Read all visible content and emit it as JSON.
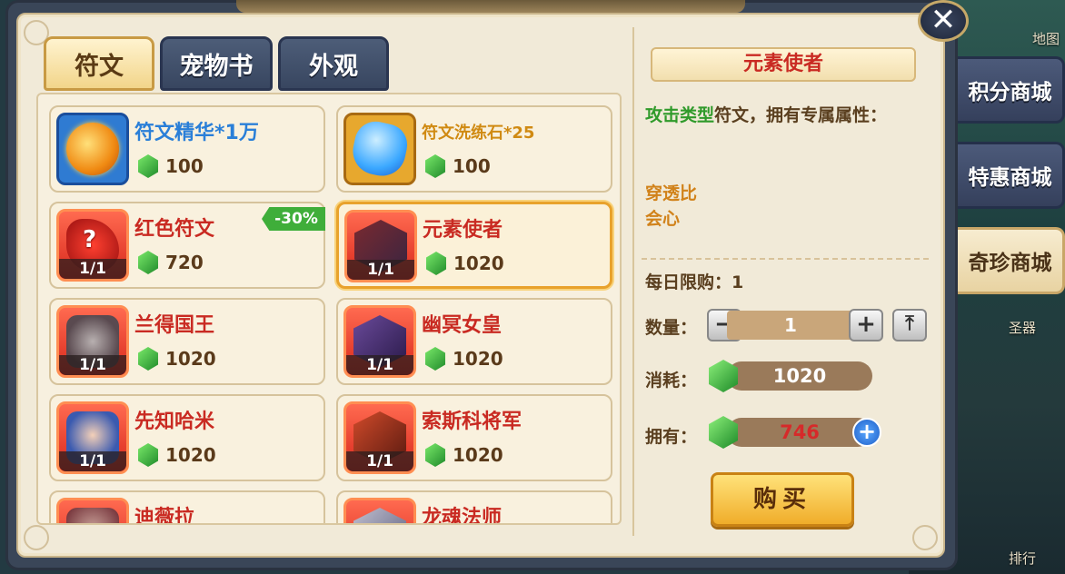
{
  "background": {
    "map_label": "地图",
    "artifact_label": "圣器",
    "rank_label": "排行"
  },
  "tabs": [
    {
      "label": "符文",
      "active": true
    },
    {
      "label": "宠物书",
      "active": false
    },
    {
      "label": "外观",
      "active": false
    }
  ],
  "items": [
    {
      "name": "符文精华*1万",
      "price": "100",
      "color": "blue",
      "icon": "gold-orb-icon"
    },
    {
      "name": "符文洗练石*25",
      "price": "100",
      "color": "gold",
      "icon": "blue-gem-icon"
    },
    {
      "name": "红色符文",
      "price": "720",
      "color": "red",
      "badge": "1/1",
      "discount": "-30%",
      "icon": "mystery-rune-icon",
      "icon_text": "?"
    },
    {
      "name": "元素使者",
      "price": "1020",
      "color": "red",
      "badge": "1/1",
      "selected": true,
      "icon": "element-envoy-portrait"
    },
    {
      "name": "兰得国王",
      "price": "1020",
      "color": "red",
      "badge": "1/1",
      "icon": "king-portrait"
    },
    {
      "name": "幽冥女皇",
      "price": "1020",
      "color": "red",
      "badge": "1/1",
      "icon": "nether-queen-portrait"
    },
    {
      "name": "先知哈米",
      "price": "1020",
      "color": "red",
      "badge": "1/1",
      "icon": "prophet-portrait"
    },
    {
      "name": "索斯科将军",
      "price": "1020",
      "color": "red",
      "badge": "1/1",
      "icon": "general-portrait"
    },
    {
      "name": "迪薇拉",
      "price": "",
      "color": "red",
      "icon": "divira-portrait"
    },
    {
      "name": "龙魂法师",
      "price": "",
      "color": "red",
      "icon": "dragon-mage-portrait"
    }
  ],
  "detail": {
    "title": "元素使者",
    "desc_type": "攻击类型",
    "desc_rest": "符文，拥有专属属性：",
    "attributes": [
      "穿透比",
      "会心"
    ],
    "daily_limit": "每日限购：1",
    "quantity_label": "数量：",
    "quantity": "1",
    "cost_label": "消耗：",
    "cost": "1020",
    "owned_label": "拥有：",
    "owned": "746",
    "buy_label": "购买",
    "minus": "−",
    "plus": "+",
    "max": "⤒"
  },
  "close_label": "✕",
  "side_tabs": [
    {
      "label": "积分商城",
      "active": false
    },
    {
      "label": "特惠商城",
      "active": false
    },
    {
      "label": "奇珍商城",
      "active": true
    }
  ],
  "colors": {
    "accent_red": "#c92a22",
    "accent_gold": "#f0ad2a",
    "accent_green": "#2f9a2a",
    "panel": "#f1ead8"
  }
}
